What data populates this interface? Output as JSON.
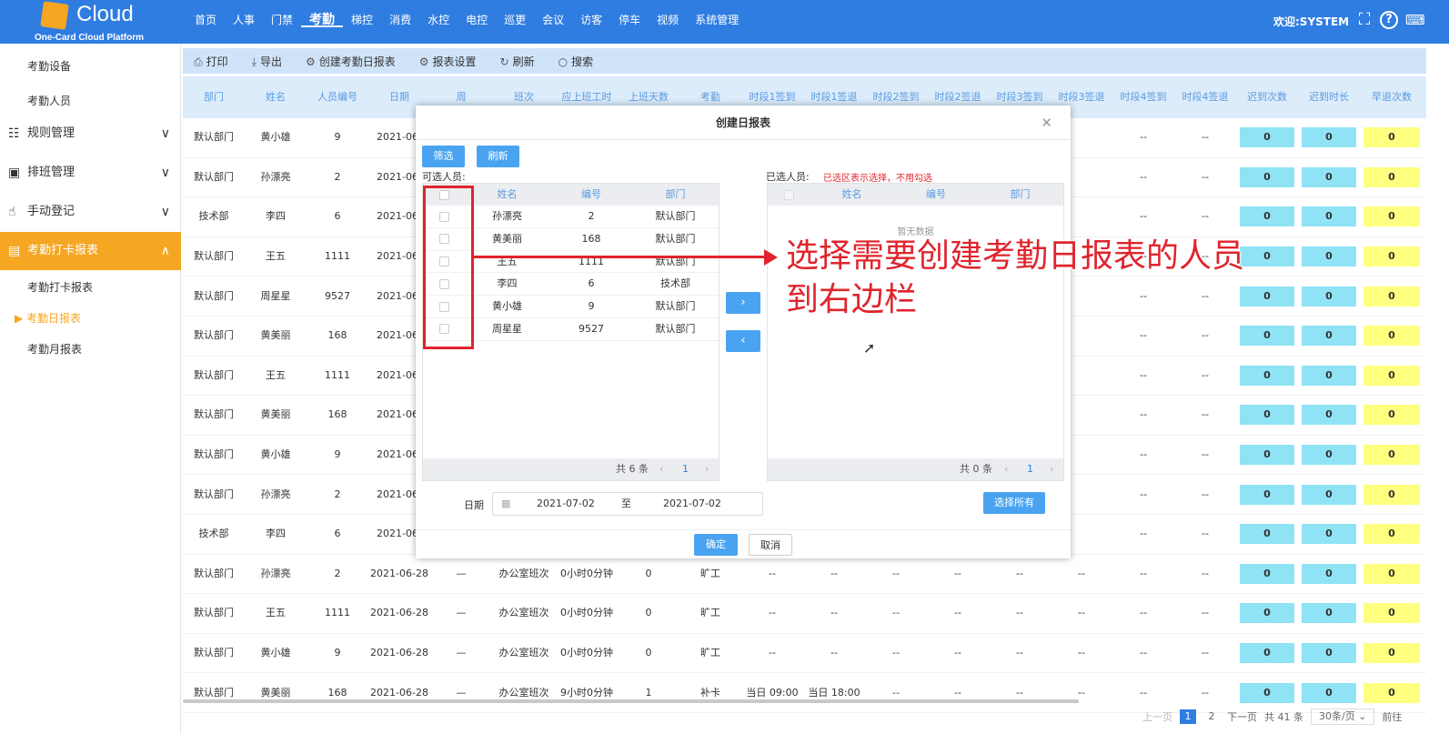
{
  "header": {
    "brand": "Cloud",
    "subtitle": "One-Card Cloud Platform",
    "welcome": "欢迎:SYSTEM",
    "nav": [
      "首页",
      "人事",
      "门禁",
      "考勤",
      "梯控",
      "消费",
      "水控",
      "电控",
      "巡更",
      "会议",
      "访客",
      "停车",
      "视频",
      "系统管理"
    ],
    "active_nav": "考勤"
  },
  "sidebar": {
    "top_items": [
      "考勤设备",
      "考勤人员"
    ],
    "groups": [
      {
        "label": "规则管理",
        "icon": "rules-icon"
      },
      {
        "label": "排班管理",
        "icon": "schedule-icon"
      },
      {
        "label": "手动登记",
        "icon": "hand-icon"
      },
      {
        "label": "考勤打卡报表",
        "icon": "chart-icon",
        "active": true
      }
    ],
    "sub_items": [
      "考勤打卡报表",
      "考勤日报表",
      "考勤月报表"
    ],
    "current": "考勤日报表"
  },
  "toolbar": {
    "print": "打印",
    "export": "导出",
    "create": "创建考勤日报表",
    "settings": "报表设置",
    "refresh": "刷新",
    "search": "搜索"
  },
  "table": {
    "columns": [
      "部门",
      "姓名",
      "人员编号",
      "日期",
      "周",
      "班次",
      "应上班工时",
      "上班天数",
      "考勤",
      "时段1签到",
      "时段1签退",
      "时段2签到",
      "时段2签退",
      "时段3签到",
      "时段3签退",
      "时段4签到",
      "时段4签退",
      "迟到次数",
      "迟到时长",
      "早退次数"
    ],
    "rows": [
      [
        "默认部门",
        "黄小雄",
        "9",
        "2021-06-",
        "",
        "",
        "",
        "",
        "",
        "",
        "",
        "",
        "",
        "",
        "",
        "--",
        "--",
        "0",
        "0",
        "0"
      ],
      [
        "默认部门",
        "孙漂亮",
        "2",
        "2021-06-",
        "",
        "",
        "",
        "",
        "",
        "",
        "",
        "",
        "",
        "",
        "",
        "--",
        "--",
        "0",
        "0",
        "0"
      ],
      [
        "技术部",
        "李四",
        "6",
        "2021-06-",
        "",
        "",
        "",
        "",
        "",
        "",
        "",
        "",
        "",
        "",
        "",
        "--",
        "--",
        "0",
        "0",
        "0"
      ],
      [
        "默认部门",
        "王五",
        "1111",
        "2021-06-",
        "",
        "",
        "",
        "",
        "",
        "",
        "",
        "",
        "",
        "",
        "",
        "--",
        "--",
        "0",
        "0",
        "0"
      ],
      [
        "默认部门",
        "周星星",
        "9527",
        "2021-06-",
        "",
        "",
        "",
        "",
        "",
        "",
        "",
        "",
        "",
        "",
        "",
        "--",
        "--",
        "0",
        "0",
        "0"
      ],
      [
        "默认部门",
        "黄美丽",
        "168",
        "2021-06-",
        "",
        "",
        "",
        "",
        "",
        "",
        "",
        "",
        "",
        "",
        "",
        "--",
        "--",
        "0",
        "0",
        "0"
      ],
      [
        "默认部门",
        "王五",
        "1111",
        "2021-06-",
        "",
        "",
        "",
        "",
        "",
        "",
        "",
        "",
        "",
        "",
        "",
        "--",
        "--",
        "0",
        "0",
        "0"
      ],
      [
        "默认部门",
        "黄美丽",
        "168",
        "2021-06-",
        "",
        "",
        "",
        "",
        "",
        "",
        "",
        "",
        "",
        "",
        "",
        "--",
        "--",
        "0",
        "0",
        "0"
      ],
      [
        "默认部门",
        "黄小雄",
        "9",
        "2021-06-",
        "",
        "",
        "",
        "",
        "",
        "",
        "",
        "",
        "",
        "",
        "",
        "--",
        "--",
        "0",
        "0",
        "0"
      ],
      [
        "默认部门",
        "孙漂亮",
        "2",
        "2021-06-",
        "",
        "",
        "",
        "",
        "",
        "",
        "",
        "",
        "",
        "",
        "",
        "--",
        "--",
        "0",
        "0",
        "0"
      ],
      [
        "技术部",
        "李四",
        "6",
        "2021-06-",
        "",
        "",
        "",
        "",
        "",
        "",
        "",
        "",
        "",
        "",
        "",
        "--",
        "--",
        "0",
        "0",
        "0"
      ],
      [
        "默认部门",
        "孙漂亮",
        "2",
        "2021-06-28",
        "—",
        "办公室班次",
        "0小时0分钟",
        "0",
        "旷工",
        "--",
        "--",
        "--",
        "--",
        "--",
        "--",
        "--",
        "--",
        "0",
        "0",
        "0"
      ],
      [
        "默认部门",
        "王五",
        "1111",
        "2021-06-28",
        "—",
        "办公室班次",
        "0小时0分钟",
        "0",
        "旷工",
        "--",
        "--",
        "--",
        "--",
        "--",
        "--",
        "--",
        "--",
        "0",
        "0",
        "0"
      ],
      [
        "默认部门",
        "黄小雄",
        "9",
        "2021-06-28",
        "—",
        "办公室班次",
        "0小时0分钟",
        "0",
        "旷工",
        "--",
        "--",
        "--",
        "--",
        "--",
        "--",
        "--",
        "--",
        "0",
        "0",
        "0"
      ],
      [
        "默认部门",
        "黄美丽",
        "168",
        "2021-06-28",
        "—",
        "办公室班次",
        "9小时0分钟",
        "1",
        "补卡",
        "当日 09:00",
        "当日 18:00",
        "--",
        "--",
        "--",
        "--",
        "--",
        "--",
        "0",
        "0",
        "0"
      ]
    ]
  },
  "pager": {
    "prev": "上一页",
    "pages": [
      "1",
      "2"
    ],
    "current": "1",
    "next": "下一页",
    "total": "共 41 条",
    "size": "30条/页",
    "goto": "前往"
  },
  "dialog": {
    "title": "创建日报表",
    "filter": "筛选",
    "refresh": "刷新",
    "available_label": "可选人员:",
    "selected_label": "已选人员:",
    "selected_hint": "已选区表示选择，不用勾选",
    "columns": [
      "姓名",
      "编号",
      "部门"
    ],
    "people": [
      [
        "孙漂亮",
        "2",
        "默认部门"
      ],
      [
        "黄美丽",
        "168",
        "默认部门"
      ],
      [
        "王五",
        "1111",
        "默认部门"
      ],
      [
        "李四",
        "6",
        "技术部"
      ],
      [
        "黄小雄",
        "9",
        "默认部门"
      ],
      [
        "周星星",
        "9527",
        "默认部门"
      ]
    ],
    "empty": "暂无数据",
    "left_total": "共 6 条",
    "right_total": "共 0 条",
    "page": "1",
    "move_right": "›",
    "move_left": "‹",
    "date_label": "日期",
    "date_from": "2021-07-02",
    "date_to_sep": "至",
    "date_to": "2021-07-02",
    "select_all": "选择所有",
    "ok": "确定",
    "cancel": "取消"
  },
  "annotation": {
    "line1": "选择需要创建考勤日报表的人员",
    "line2": "到右边栏",
    "color": "#e0242d"
  },
  "colors": {
    "primary": "#2f7de1",
    "accent": "#f5a623",
    "late": "#8fe3f5",
    "early": "#ffff80"
  }
}
